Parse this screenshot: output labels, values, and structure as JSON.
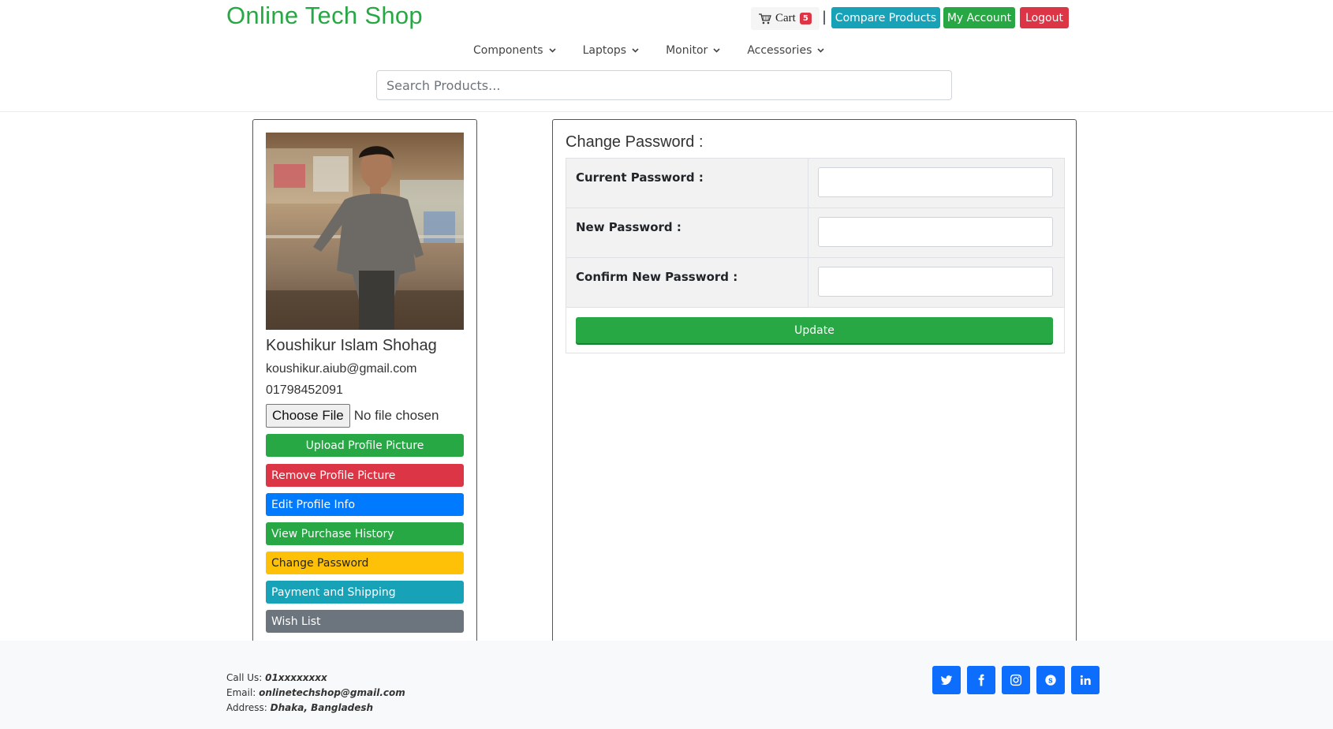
{
  "header": {
    "brand": "Online Tech Shop",
    "cart_label": "Cart",
    "cart_count": "5",
    "separator": "|",
    "compare_label": "Compare Products",
    "account_label": "My Account",
    "logout_label": "Logout"
  },
  "nav": {
    "items": [
      {
        "label": "Components"
      },
      {
        "label": "Laptops"
      },
      {
        "label": "Monitor"
      },
      {
        "label": "Accessories"
      }
    ]
  },
  "search": {
    "placeholder": "Search Products..."
  },
  "profile": {
    "name": "Koushikur Islam Shohag",
    "email": "koushikur.aiub@gmail.com",
    "phone": "01798452091",
    "choose_file_label": "Choose File",
    "no_file_text": "No file chosen",
    "buttons": [
      {
        "label": "Upload Profile Picture",
        "color": "#28a745"
      },
      {
        "label": "Remove Profile Picture",
        "color": "#dc3545"
      },
      {
        "label": "Edit Profile Info",
        "color": "#007bff"
      },
      {
        "label": "View Purchase History",
        "color": "#28a745"
      },
      {
        "label": "Change Password",
        "color": "#ffc107"
      },
      {
        "label": "Payment and Shipping",
        "color": "#17a2b8"
      },
      {
        "label": "Wish List",
        "color": "#6c757d"
      }
    ]
  },
  "change_password": {
    "title": "Change Password :",
    "fields": [
      {
        "label": "Current Password :"
      },
      {
        "label": "New Password :"
      },
      {
        "label": "Confirm New Password :"
      }
    ],
    "update_label": "Update"
  },
  "footer": {
    "call_label": "Call Us: ",
    "call_value": "01xxxxxxxx",
    "email_label": "Email: ",
    "email_value": "onlinetechshop@gmail.com",
    "address_label": "Address: ",
    "address_value": "Dhaka, Bangladesh",
    "social": [
      "twitter-icon",
      "facebook-icon",
      "instagram-icon",
      "skype-icon",
      "linkedin-icon"
    ]
  },
  "colors": {
    "brand": "#28a745",
    "success": "#28a745",
    "danger": "#dc3545",
    "info": "#17a2b8",
    "primary": "#007bff",
    "warning": "#ffc107",
    "secondary": "#6c757d",
    "social": "#0d6efd"
  }
}
